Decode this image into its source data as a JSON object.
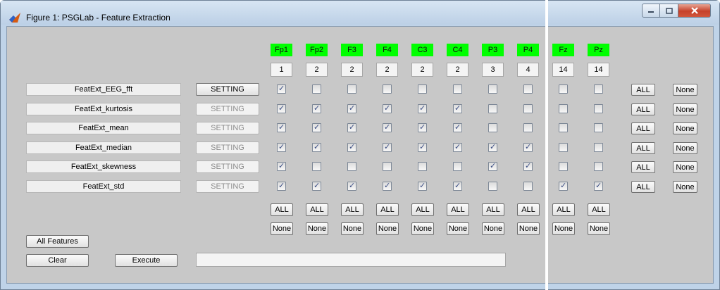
{
  "window": {
    "title": "Figure 1: PSGLab - Feature Extraction"
  },
  "channels": [
    {
      "label": "Fp1",
      "value": "1"
    },
    {
      "label": "Fp2",
      "value": "2"
    },
    {
      "label": "F3",
      "value": "2"
    },
    {
      "label": "F4",
      "value": "2"
    },
    {
      "label": "C3",
      "value": "2"
    },
    {
      "label": "C4",
      "value": "2"
    },
    {
      "label": "P3",
      "value": "3"
    },
    {
      "label": "P4",
      "value": "4"
    },
    {
      "label": "Fz",
      "value": "14"
    },
    {
      "label": "Pz",
      "value": "14"
    }
  ],
  "channel_color": "#00ff00",
  "features": [
    {
      "name": "FeatExt_EEG_fft",
      "setting": "SETTING",
      "setting_enabled": true,
      "checks": [
        true,
        false,
        false,
        false,
        false,
        false,
        false,
        false,
        false,
        false
      ]
    },
    {
      "name": "FeatExt_kurtosis",
      "setting": "SETTING",
      "setting_enabled": false,
      "checks": [
        true,
        true,
        true,
        true,
        true,
        true,
        false,
        false,
        false,
        false
      ]
    },
    {
      "name": "FeatExt_mean",
      "setting": "SETTING",
      "setting_enabled": false,
      "checks": [
        true,
        true,
        true,
        true,
        true,
        true,
        false,
        false,
        false,
        false
      ]
    },
    {
      "name": "FeatExt_median",
      "setting": "SETTING",
      "setting_enabled": false,
      "checks": [
        true,
        true,
        true,
        true,
        true,
        true,
        true,
        true,
        false,
        false
      ]
    },
    {
      "name": "FeatExt_skewness",
      "setting": "SETTING",
      "setting_enabled": false,
      "checks": [
        true,
        false,
        false,
        false,
        false,
        false,
        true,
        true,
        false,
        false
      ]
    },
    {
      "name": "FeatExt_std",
      "setting": "SETTING",
      "setting_enabled": false,
      "checks": [
        true,
        true,
        true,
        true,
        true,
        true,
        false,
        false,
        true,
        true
      ]
    }
  ],
  "row_all_label": "ALL",
  "row_none_label": "None",
  "col_all_label": "ALL",
  "col_none_label": "None",
  "buttons": {
    "all_features": "All Features",
    "clear": "Clear",
    "execute": "Execute"
  },
  "status_text": ""
}
